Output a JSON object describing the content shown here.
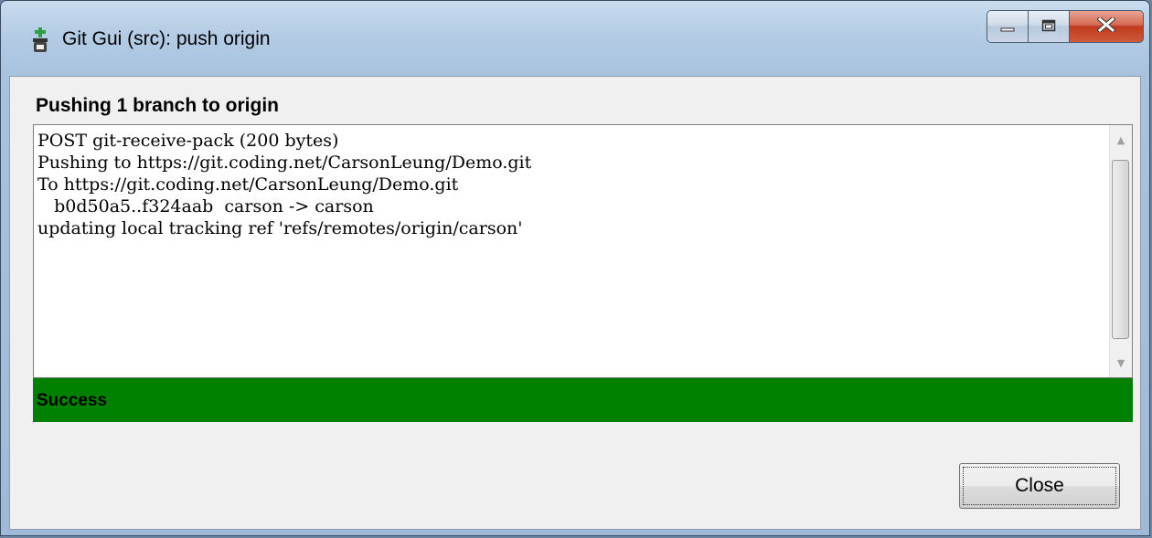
{
  "window": {
    "title": "Git Gui (src): push origin"
  },
  "icons": {
    "app": "git-gui-icon",
    "minimize": "minimize-icon",
    "maximize": "maximize-icon",
    "close": "close-icon",
    "scroll_up": "scroll-up-arrow-icon",
    "scroll_down": "scroll-down-arrow-icon"
  },
  "dialog": {
    "heading": "Pushing 1 branch to origin",
    "log_lines": [
      "POST git-receive-pack (200 bytes)",
      "Pushing to https://git.coding.net/CarsonLeung/Demo.git",
      "To https://git.coding.net/CarsonLeung/Demo.git",
      "   b0d50a5..f324aab  carson -> carson",
      "updating local tracking ref 'refs/remotes/origin/carson'"
    ],
    "status": "Success",
    "close_label": "Close"
  },
  "colors": {
    "status_success": "#008000",
    "close_caption": "#c7402a"
  }
}
